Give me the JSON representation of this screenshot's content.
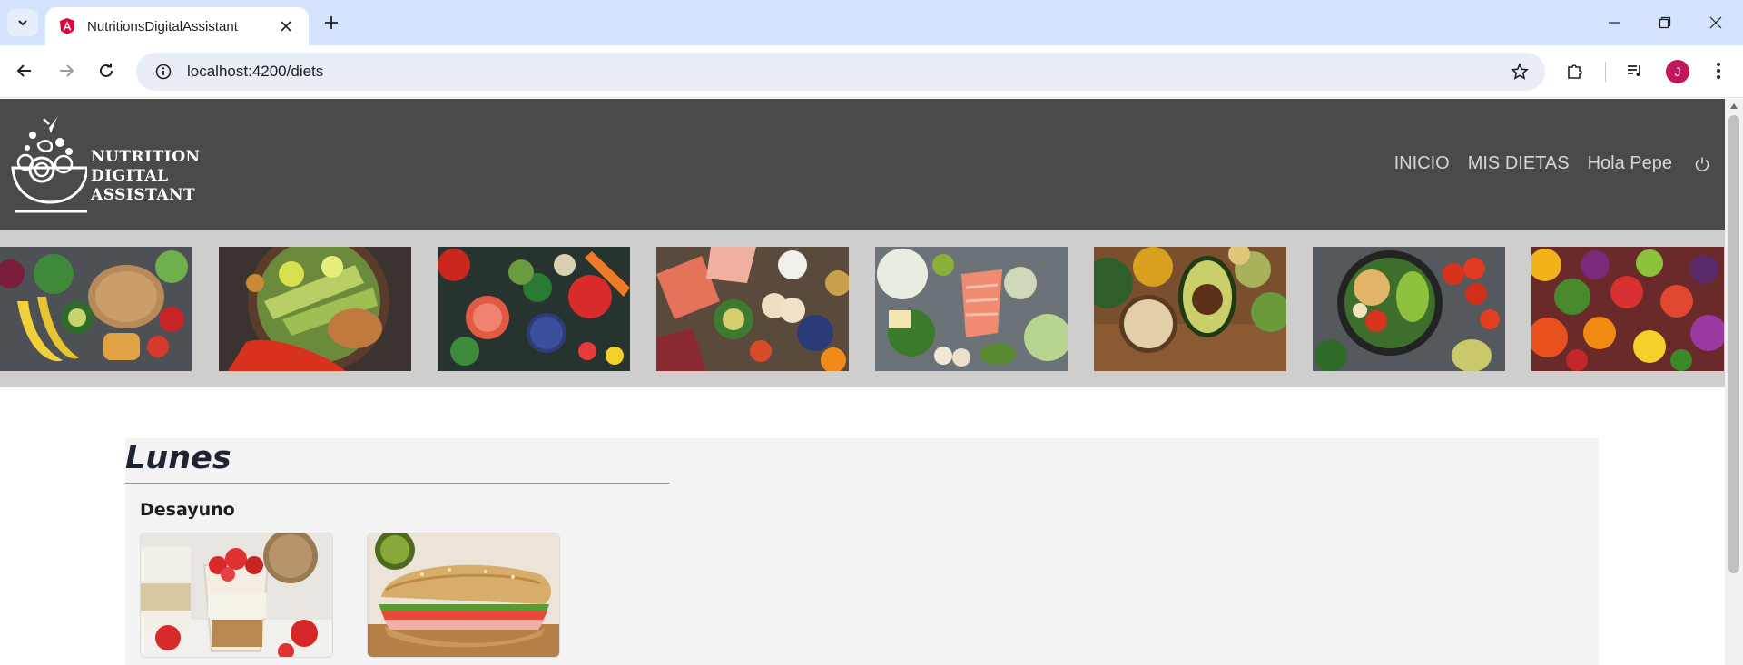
{
  "browser": {
    "tab_title": "NutritionsDigitalAssistant",
    "url": "localhost:4200/diets",
    "profile_initial": "J"
  },
  "header": {
    "logo_lines": [
      "NUTRITION",
      "DIGITAL",
      "ASSISTANT"
    ],
    "nav": {
      "home": "INICIO",
      "my_diets": "MIS DIETAS",
      "greeting": "Hola Pepe"
    }
  },
  "gallery": {
    "images": [
      "produce-bread-banana",
      "salad-bowl-avocado",
      "vegetables-berries-top",
      "protein-vegetables-mix",
      "salmon-greens-eggs",
      "spices-avocado-oats",
      "chickpea-bowl-tomatoes",
      "colorful-fruits-vegetables"
    ]
  },
  "diet": {
    "day": "Lunes",
    "meal": "Desayuno",
    "meal_images": [
      "strawberry-parfait",
      "sandwich-baguette"
    ]
  },
  "colors": {
    "header_bg": "#4a4a4a",
    "gallery_bg": "#d0cecc",
    "card_bg": "#f3f3f3",
    "tabstrip_bg": "#d3e3fd"
  }
}
